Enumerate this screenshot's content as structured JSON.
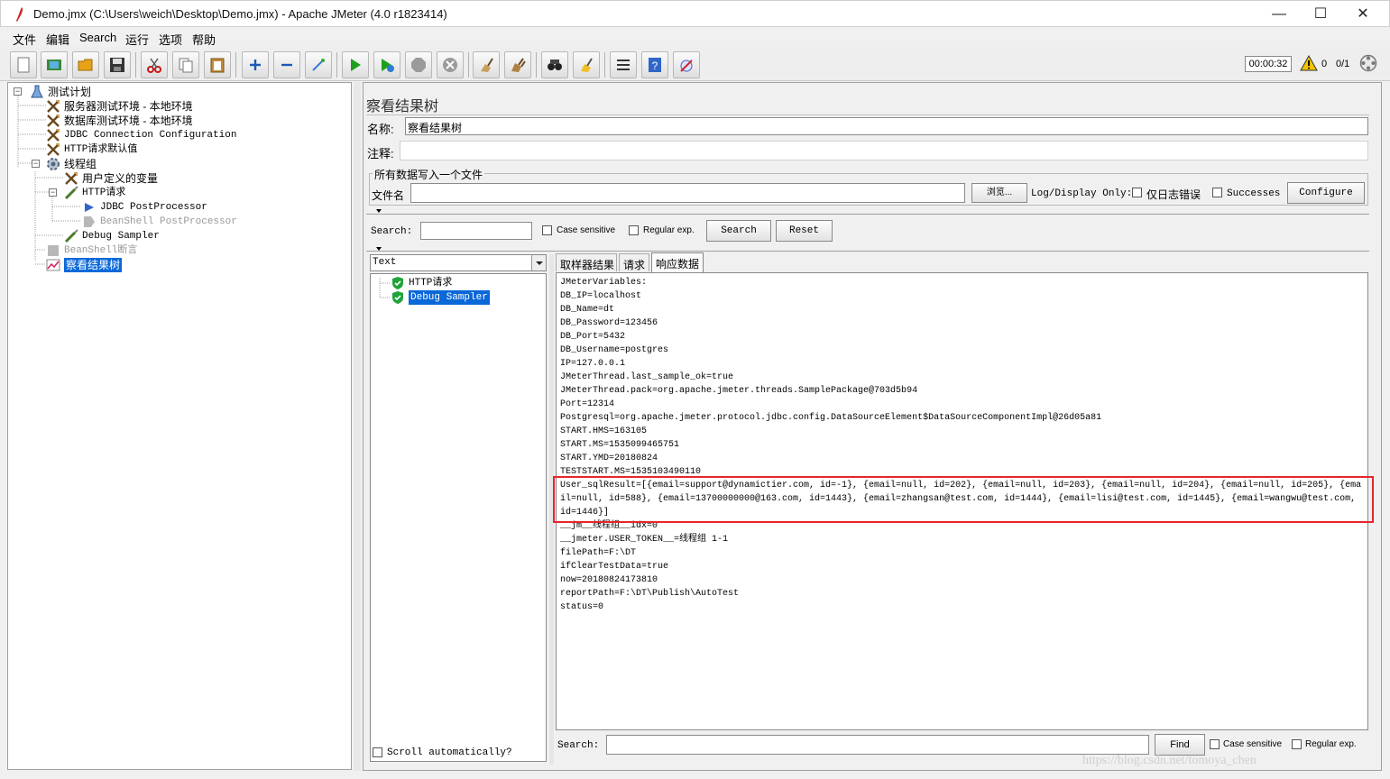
{
  "window": {
    "title": "Demo.jmx (C:\\Users\\weich\\Desktop\\Demo.jmx) - Apache JMeter (4.0 r1823414)",
    "minimize": "—",
    "maximize": "☐",
    "close": "✕"
  },
  "menu": [
    "文件",
    "编辑",
    "Search",
    "运行",
    "选项",
    "帮助"
  ],
  "status": {
    "timer": "00:00:32",
    "warnings": "0",
    "threads": "0/1"
  },
  "tree": [
    {
      "label": "测试计划"
    },
    {
      "label": "服务器测试环境 - 本地环境"
    },
    {
      "label": "数据库测试环境 - 本地环境"
    },
    {
      "label": "JDBC Connection Configuration"
    },
    {
      "label": "HTTP请求默认值"
    },
    {
      "label": "线程组"
    },
    {
      "label": "用户定义的变量"
    },
    {
      "label": "HTTP请求"
    },
    {
      "label": "JDBC PostProcessor"
    },
    {
      "label": "BeanShell PostProcessor"
    },
    {
      "label": "Debug Sampler"
    },
    {
      "label": "BeanShell断言"
    },
    {
      "label": "察看结果树"
    }
  ],
  "panel": {
    "title": "察看结果树",
    "name_label": "名称:",
    "name_value": "察看结果树",
    "comment_label": "注释:",
    "file_group": "所有数据写入一个文件",
    "file_label": "文件名",
    "browse": "浏览...",
    "log_display": "Log/Display Only:",
    "errors_only": "仅日志错误",
    "successes": "Successes",
    "configure": "Configure",
    "search_label": "Search:",
    "case_sensitive": "Case sensitive",
    "regular_exp": "Regular exp.",
    "search_btn": "Search",
    "reset_btn": "Reset",
    "renderer": "Text",
    "samples": [
      "HTTP请求",
      "Debug Sampler"
    ],
    "scroll_auto": "Scroll automatically?",
    "tabs": [
      "取样器结果",
      "请求",
      "响应数据"
    ],
    "bottom_search_label": "Search:",
    "find_btn": "Find",
    "bottom_case": "Case sensitive",
    "bottom_regex": "Regular exp."
  },
  "response": [
    "JMeterVariables:",
    "DB_IP=localhost",
    "DB_Name=dt",
    "DB_Password=123456",
    "DB_Port=5432",
    "DB_Username=postgres",
    "IP=127.0.0.1",
    "JMeterThread.last_sample_ok=true",
    "JMeterThread.pack=org.apache.jmeter.threads.SamplePackage@703d5b94",
    "Port=12314",
    "Postgresql=org.apache.jmeter.protocol.jdbc.config.DataSourceElement$DataSourceComponentImpl@26d05a81",
    "START.HMS=163105",
    "START.MS=1535099465751",
    "START.YMD=20180824",
    "TESTSTART.MS=1535103490110",
    "User_sqlResult=[{email=support@dynamictier.com, id=-1}, {email=null, id=202}, {email=null, id=203}, {email=null, id=204}, {email=null, id=205}, {ema",
    "il=null, id=588}, {email=13700000000@163.com, id=1443}, {email=zhangsan@test.com, id=1444}, {email=lisi@test.com, id=1445}, {email=wangwu@test.com,",
    "id=1446}]",
    "__jm__线程组__idx=0",
    "__jmeter.USER_TOKEN__=线程组 1-1",
    "filePath=F:\\DT",
    "ifClearTestData=true",
    "now=20180824173810",
    "reportPath=F:\\DT\\Publish\\AutoTest",
    "status=0"
  ],
  "watermark": "https://blog.csdn.net/tomoya_chen"
}
